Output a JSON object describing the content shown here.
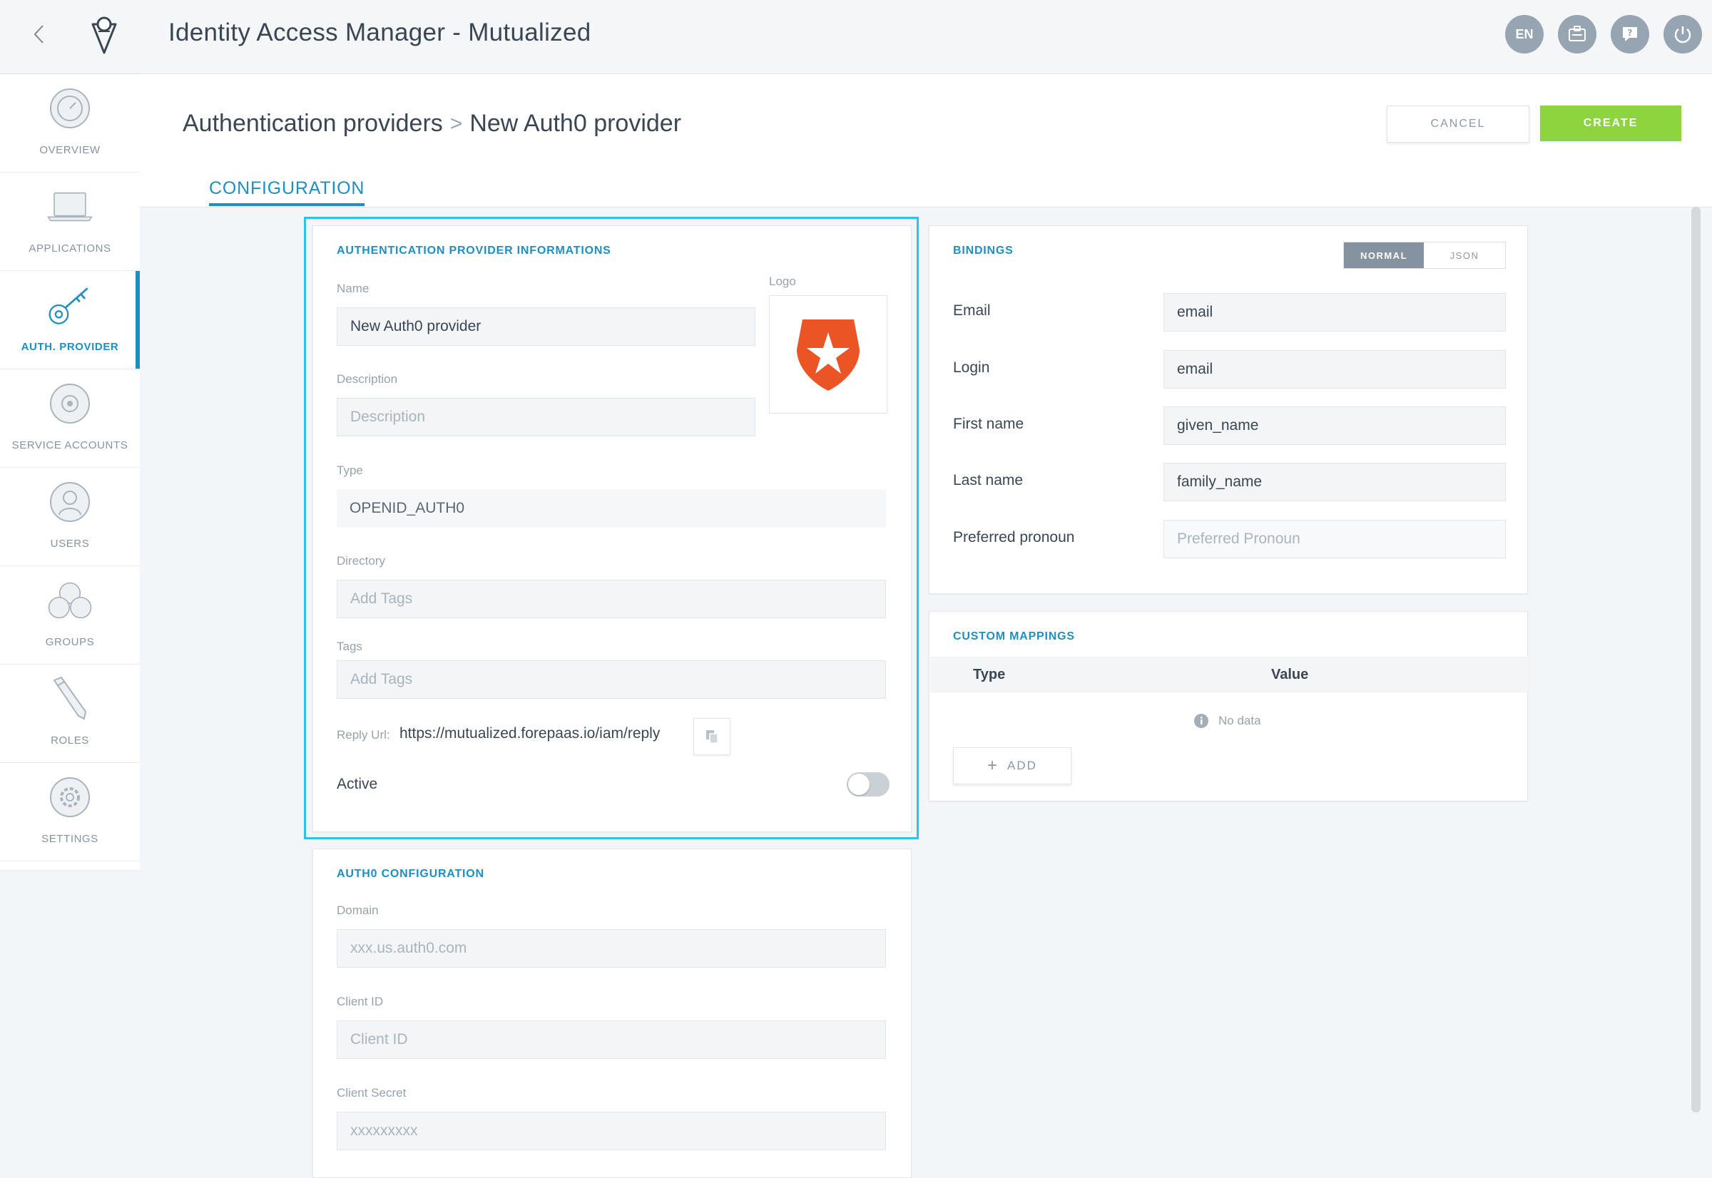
{
  "app": {
    "title": "Identity Access Manager - Mutualized"
  },
  "topbar": {
    "language": "EN"
  },
  "sidebar": {
    "items": [
      {
        "label": "OVERVIEW",
        "icon": "dashboard-icon"
      },
      {
        "label": "APPLICATIONS",
        "icon": "laptop-icon"
      },
      {
        "label": "AUTH. PROVIDER",
        "icon": "key-icon",
        "active": true
      },
      {
        "label": "SERVICE ACCOUNTS",
        "icon": "service-account-icon"
      },
      {
        "label": "USERS",
        "icon": "user-icon"
      },
      {
        "label": "GROUPS",
        "icon": "group-icon"
      },
      {
        "label": "ROLES",
        "icon": "pencil-icon"
      },
      {
        "label": "SETTINGS",
        "icon": "gear-icon"
      }
    ]
  },
  "header": {
    "breadcrumb_parent": "Authentication providers",
    "breadcrumb_separator": ">",
    "breadcrumb_current": "New Auth0 provider",
    "cancel_label": "CANCEL",
    "create_label": "CREATE",
    "tab_label": "CONFIGURATION"
  },
  "info_card": {
    "title": "AUTHENTICATION PROVIDER INFORMATIONS",
    "name_label": "Name",
    "name_value": "New Auth0 provider",
    "logo_label": "Logo",
    "description_label": "Description",
    "description_placeholder": "Description",
    "type_label": "Type",
    "type_value": "OPENID_AUTH0",
    "directory_label": "Directory",
    "directory_placeholder": "Add Tags",
    "tags_label": "Tags",
    "tags_placeholder": "Add Tags",
    "reply_url_label": "Reply Url:",
    "reply_url_value": "https://mutualized.forepaas.io/iam/reply",
    "active_label": "Active",
    "active": false
  },
  "auth0_card": {
    "title": "AUTH0 CONFIGURATION",
    "domain_label": "Domain",
    "domain_placeholder": "xxx.us.auth0.com",
    "client_id_label": "Client ID",
    "client_id_placeholder": "Client ID",
    "client_secret_label": "Client Secret",
    "client_secret_placeholder": "xxxxxxxxx"
  },
  "bindings_card": {
    "title": "BINDINGS",
    "mode_normal": "NORMAL",
    "mode_json": "JSON",
    "rows": [
      {
        "label": "Email",
        "value": "email",
        "placeholder": ""
      },
      {
        "label": "Login",
        "value": "email",
        "placeholder": ""
      },
      {
        "label": "First name",
        "value": "given_name",
        "placeholder": ""
      },
      {
        "label": "Last name",
        "value": "family_name",
        "placeholder": ""
      },
      {
        "label": "Preferred pronoun",
        "value": "",
        "placeholder": "Preferred Pronoun"
      }
    ]
  },
  "mappings_card": {
    "title": "CUSTOM MAPPINGS",
    "col_type": "Type",
    "col_value": "Value",
    "empty_text": "No data",
    "add_label": "ADD"
  },
  "colors": {
    "accent": "#1e8fc2",
    "create_button": "#8ed43e",
    "highlight_border": "#2bc3ec",
    "auth0_logo": "#eb5424"
  }
}
